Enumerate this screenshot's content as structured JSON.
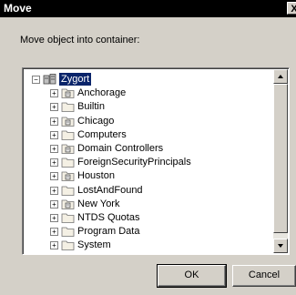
{
  "window": {
    "title": "Move",
    "close_label": "X"
  },
  "prompt": "Move object into container:",
  "tree": {
    "root": {
      "label": "Zygort",
      "expanded": true,
      "selected": true
    },
    "children": [
      {
        "label": "Anchorage",
        "icon": "ou-folder-icon"
      },
      {
        "label": "Builtin",
        "icon": "folder-icon"
      },
      {
        "label": "Chicago",
        "icon": "ou-folder-icon"
      },
      {
        "label": "Computers",
        "icon": "folder-icon"
      },
      {
        "label": "Domain Controllers",
        "icon": "ou-folder-icon"
      },
      {
        "label": "ForeignSecurityPrincipals",
        "icon": "folder-icon"
      },
      {
        "label": "Houston",
        "icon": "ou-folder-icon"
      },
      {
        "label": "LostAndFound",
        "icon": "folder-icon"
      },
      {
        "label": "New York",
        "icon": "ou-folder-icon"
      },
      {
        "label": "NTDS Quotas",
        "icon": "folder-icon"
      },
      {
        "label": "Program Data",
        "icon": "folder-icon"
      },
      {
        "label": "System",
        "icon": "folder-icon"
      }
    ],
    "expander_collapsed": "+",
    "expander_expanded": "−"
  },
  "buttons": {
    "ok": "OK",
    "cancel": "Cancel"
  },
  "colors": {
    "selection": "#0a246a",
    "dialog_bg": "#d4d0c8",
    "title_bg": "#000000"
  }
}
